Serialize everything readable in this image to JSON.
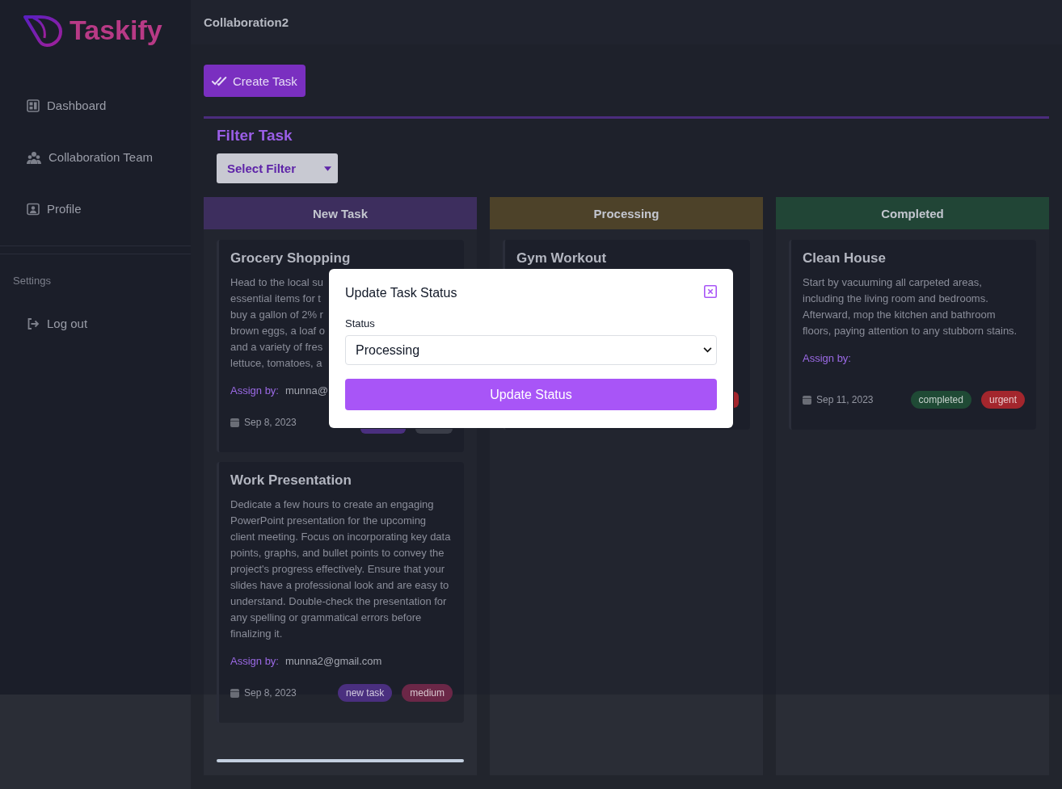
{
  "sidebar": {
    "logo_text": "Taskify",
    "items": [
      {
        "label": "Dashboard"
      },
      {
        "label": "Collaboration Team"
      },
      {
        "label": "Profile"
      }
    ],
    "section_label": "Settings",
    "logout": "Log out"
  },
  "header": {
    "title": "Collaboration2"
  },
  "toolbar": {
    "create_button": "Create Task",
    "filter_title": "Filter Task",
    "filter_select": {
      "value": "Select Filter"
    }
  },
  "columns": [
    {
      "title": "New Task",
      "color": "#3d2e5e",
      "cards": [
        {
          "title": "Grocery Shopping",
          "description_lines": [
            "Head to the local su",
            "essential items for t",
            "buy a gallon of 2% r",
            "brown eggs, a loaf o",
            "and a variety of fres",
            "lettuce, tomatoes, a"
          ],
          "assign_label": "Assign by:",
          "assignee": "munna@",
          "date": "Sep 8, 2023",
          "tags": [
            {
              "color": "#4a2f7f"
            },
            {
              "color": "#3a3d48"
            }
          ]
        },
        {
          "title": "Work Presentation",
          "description": "Dedicate a few hours to create an engaging PowerPoint presentation for the upcoming client meeting. Focus on incorporating key data points, graphs, and bullet points to convey the project's progress effectively. Ensure that your slides have a professional look and are easy to understand. Double-check the presentation for any spelling or grammatical errors before finalizing it.",
          "assign_label": "Assign by:",
          "assignee": "munna2@gmail.com",
          "date": "Sep 8, 2023",
          "tags": [
            {
              "label": "new task",
              "color": "#4a2f7f"
            },
            {
              "label": "medium",
              "color": "#6b2747"
            }
          ]
        }
      ]
    },
    {
      "title": "Processing",
      "color": "#4d4229",
      "cards": [
        {
          "title": "Gym Workout",
          "tags": [
            {
              "color": "#a3262d"
            }
          ]
        }
      ]
    },
    {
      "title": "Completed",
      "color": "#214536",
      "cards": [
        {
          "title": "Clean House",
          "description": "Start by vacuuming all carpeted areas, including the living room and bedrooms. Afterward, mop the kitchen and bathroom floors, paying attention to any stubborn stains.",
          "assign_label": "Assign by:",
          "date": "Sep 11, 2023",
          "tags": [
            {
              "label": "completed",
              "color": "#1f4a35"
            },
            {
              "label": "urgent",
              "color": "#a3262d"
            }
          ]
        }
      ]
    }
  ],
  "modal": {
    "title": "Update Task Status",
    "field_label": "Status",
    "select": {
      "value": "Processing"
    },
    "button": "Update Status"
  }
}
